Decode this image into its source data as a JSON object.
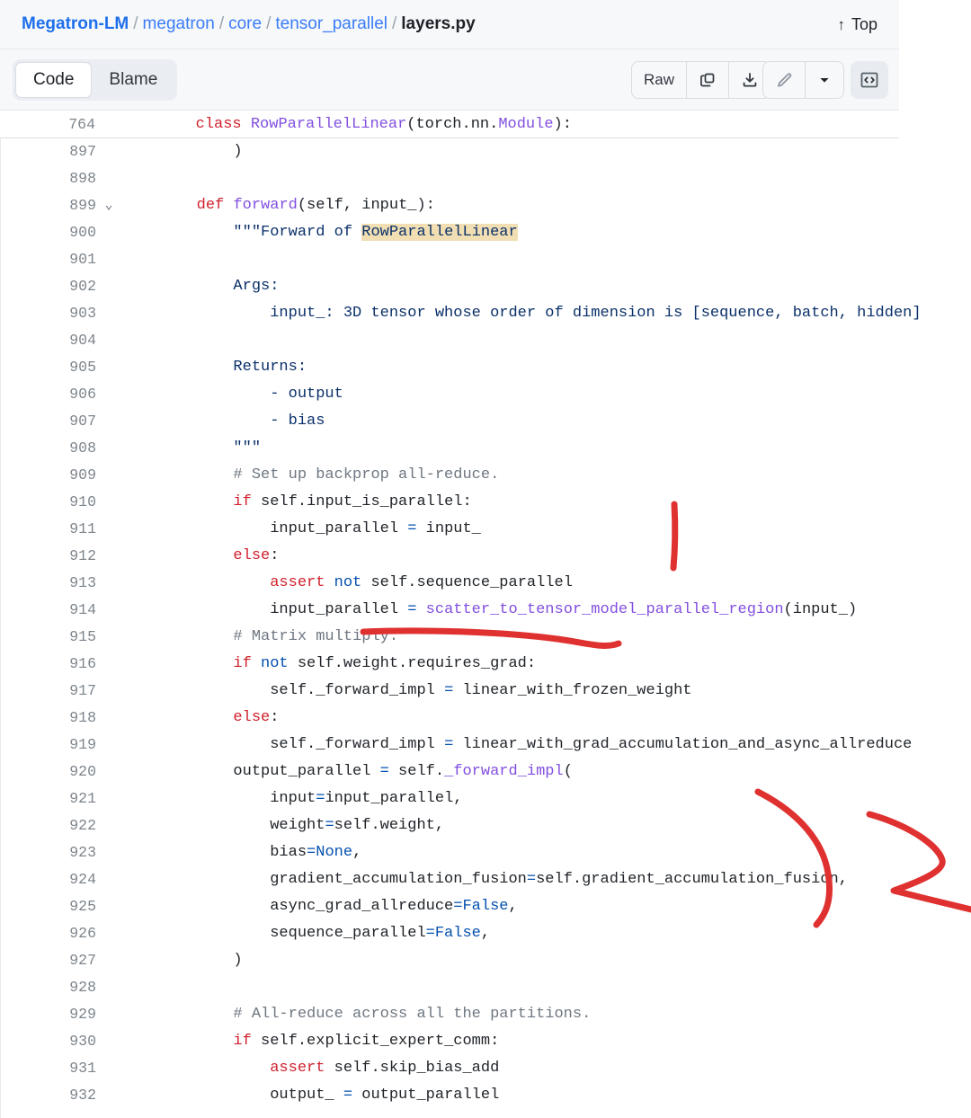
{
  "header": {
    "breadcrumb": {
      "repo": "Megatron-LM",
      "parts": [
        "megatron",
        "core",
        "tensor_parallel"
      ],
      "file": "layers.py",
      "separator": "/"
    },
    "top_label": "Top",
    "top_arrow": "↑"
  },
  "toolbar": {
    "tabs": [
      {
        "label": "Code",
        "active": true
      },
      {
        "label": "Blame",
        "active": false
      }
    ],
    "raw_label": "Raw",
    "icons": {
      "copy": "copy-icon",
      "download": "download-icon",
      "edit": "pencil-icon",
      "dropdown": "chevron-down-icon",
      "code_view": "code-symbol-icon"
    }
  },
  "sticky_line": {
    "number": "764",
    "tokens": [
      {
        "t": "        ",
        "c": ""
      },
      {
        "t": "class",
        "c": "kw"
      },
      {
        "t": " ",
        "c": ""
      },
      {
        "t": "RowParallelLinear",
        "c": "fn"
      },
      {
        "t": "(torch.nn.",
        "c": ""
      },
      {
        "t": "Module",
        "c": "fn"
      },
      {
        "t": "):",
        "c": ""
      }
    ]
  },
  "colors": {
    "keyword": "#cf222e",
    "constant": "#0550ae",
    "string": "#0a3069",
    "comment": "#6e7781",
    "function": "#8250df",
    "highlight": "#f1dfb3",
    "annotation": "#e03131",
    "link": "#3b7cf6",
    "chrome": "#f6f8fa"
  },
  "code_lines": [
    {
      "n": "897",
      "chev": false,
      "tokens": [
        {
          "t": "            )",
          "c": ""
        }
      ]
    },
    {
      "n": "898",
      "chev": false,
      "tokens": []
    },
    {
      "n": "899",
      "chev": true,
      "tokens": [
        {
          "t": "        ",
          "c": ""
        },
        {
          "t": "def",
          "c": "kw"
        },
        {
          "t": " ",
          "c": ""
        },
        {
          "t": "forward",
          "c": "fn"
        },
        {
          "t": "(self, input_):",
          "c": ""
        }
      ]
    },
    {
      "n": "900",
      "chev": false,
      "tokens": [
        {
          "t": "            ",
          "c": ""
        },
        {
          "t": "\"\"\"Forward of ",
          "c": "str"
        },
        {
          "t": "RowParallelLinear",
          "c": "str hl"
        }
      ]
    },
    {
      "n": "901",
      "chev": false,
      "tokens": []
    },
    {
      "n": "902",
      "chev": false,
      "tokens": [
        {
          "t": "            Args:",
          "c": "str"
        }
      ]
    },
    {
      "n": "903",
      "chev": false,
      "tokens": [
        {
          "t": "                input_: 3D tensor whose order of dimension is [sequence, batch, hidden]",
          "c": "str"
        }
      ]
    },
    {
      "n": "904",
      "chev": false,
      "tokens": []
    },
    {
      "n": "905",
      "chev": false,
      "tokens": [
        {
          "t": "            Returns:",
          "c": "str"
        }
      ]
    },
    {
      "n": "906",
      "chev": false,
      "tokens": [
        {
          "t": "                - output",
          "c": "str"
        }
      ]
    },
    {
      "n": "907",
      "chev": false,
      "tokens": [
        {
          "t": "                - bias",
          "c": "str"
        }
      ]
    },
    {
      "n": "908",
      "chev": false,
      "tokens": [
        {
          "t": "            \"\"\"",
          "c": "str"
        }
      ]
    },
    {
      "n": "909",
      "chev": false,
      "tokens": [
        {
          "t": "            # Set up backprop all-reduce.",
          "c": "com"
        }
      ]
    },
    {
      "n": "910",
      "chev": false,
      "tokens": [
        {
          "t": "            ",
          "c": ""
        },
        {
          "t": "if",
          "c": "kw"
        },
        {
          "t": " self.input_is_parallel:",
          "c": ""
        }
      ]
    },
    {
      "n": "911",
      "chev": false,
      "tokens": [
        {
          "t": "                input_parallel ",
          "c": ""
        },
        {
          "t": "=",
          "c": "op"
        },
        {
          "t": " input_",
          "c": ""
        }
      ]
    },
    {
      "n": "912",
      "chev": false,
      "tokens": [
        {
          "t": "            ",
          "c": ""
        },
        {
          "t": "else",
          "c": "kw"
        },
        {
          "t": ":",
          "c": ""
        }
      ]
    },
    {
      "n": "913",
      "chev": false,
      "tokens": [
        {
          "t": "                ",
          "c": ""
        },
        {
          "t": "assert",
          "c": "kw"
        },
        {
          "t": " ",
          "c": ""
        },
        {
          "t": "not",
          "c": "con"
        },
        {
          "t": " self.sequence_parallel",
          "c": ""
        }
      ]
    },
    {
      "n": "914",
      "chev": false,
      "tokens": [
        {
          "t": "                input_parallel ",
          "c": ""
        },
        {
          "t": "=",
          "c": "op"
        },
        {
          "t": " ",
          "c": ""
        },
        {
          "t": "scatter_to_tensor_model_parallel_region",
          "c": "fn"
        },
        {
          "t": "(input_)",
          "c": ""
        }
      ]
    },
    {
      "n": "915",
      "chev": false,
      "tokens": [
        {
          "t": "            # Matrix multiply.",
          "c": "com"
        }
      ]
    },
    {
      "n": "916",
      "chev": false,
      "tokens": [
        {
          "t": "            ",
          "c": ""
        },
        {
          "t": "if",
          "c": "kw"
        },
        {
          "t": " ",
          "c": ""
        },
        {
          "t": "not",
          "c": "con"
        },
        {
          "t": " self.weight.requires_grad:",
          "c": ""
        }
      ]
    },
    {
      "n": "917",
      "chev": false,
      "tokens": [
        {
          "t": "                self._forward_impl ",
          "c": ""
        },
        {
          "t": "=",
          "c": "op"
        },
        {
          "t": " linear_with_frozen_weight",
          "c": ""
        }
      ]
    },
    {
      "n": "918",
      "chev": false,
      "tokens": [
        {
          "t": "            ",
          "c": ""
        },
        {
          "t": "else",
          "c": "kw"
        },
        {
          "t": ":",
          "c": ""
        }
      ]
    },
    {
      "n": "919",
      "chev": false,
      "tokens": [
        {
          "t": "                self._forward_impl ",
          "c": ""
        },
        {
          "t": "=",
          "c": "op"
        },
        {
          "t": " linear_with_grad_accumulation_and_async_allreduce",
          "c": ""
        }
      ]
    },
    {
      "n": "920",
      "chev": false,
      "tokens": [
        {
          "t": "            output_parallel ",
          "c": ""
        },
        {
          "t": "=",
          "c": "op"
        },
        {
          "t": " self.",
          "c": ""
        },
        {
          "t": "_forward_impl",
          "c": "fn"
        },
        {
          "t": "(",
          "c": ""
        }
      ]
    },
    {
      "n": "921",
      "chev": false,
      "tokens": [
        {
          "t": "                input",
          "c": ""
        },
        {
          "t": "=",
          "c": "op"
        },
        {
          "t": "input_parallel,",
          "c": ""
        }
      ]
    },
    {
      "n": "922",
      "chev": false,
      "tokens": [
        {
          "t": "                weight",
          "c": ""
        },
        {
          "t": "=",
          "c": "op"
        },
        {
          "t": "self.weight,",
          "c": ""
        }
      ]
    },
    {
      "n": "923",
      "chev": false,
      "tokens": [
        {
          "t": "                bias",
          "c": ""
        },
        {
          "t": "=",
          "c": "op"
        },
        {
          "t": "None",
          "c": "con"
        },
        {
          "t": ",",
          "c": ""
        }
      ]
    },
    {
      "n": "924",
      "chev": false,
      "tokens": [
        {
          "t": "                gradient_accumulation_fusion",
          "c": ""
        },
        {
          "t": "=",
          "c": "op"
        },
        {
          "t": "self.gradient_accumulation_fusion,",
          "c": ""
        }
      ]
    },
    {
      "n": "925",
      "chev": false,
      "tokens": [
        {
          "t": "                async_grad_allreduce",
          "c": ""
        },
        {
          "t": "=",
          "c": "op"
        },
        {
          "t": "False",
          "c": "con"
        },
        {
          "t": ",",
          "c": ""
        }
      ]
    },
    {
      "n": "926",
      "chev": false,
      "tokens": [
        {
          "t": "                sequence_parallel",
          "c": ""
        },
        {
          "t": "=",
          "c": "op"
        },
        {
          "t": "False",
          "c": "con"
        },
        {
          "t": ",",
          "c": ""
        }
      ]
    },
    {
      "n": "927",
      "chev": false,
      "tokens": [
        {
          "t": "            )",
          "c": ""
        }
      ]
    },
    {
      "n": "928",
      "chev": false,
      "tokens": []
    },
    {
      "n": "929",
      "chev": false,
      "tokens": [
        {
          "t": "            # All-reduce across all the partitions.",
          "c": "com"
        }
      ]
    },
    {
      "n": "930",
      "chev": false,
      "tokens": [
        {
          "t": "            ",
          "c": ""
        },
        {
          "t": "if",
          "c": "kw"
        },
        {
          "t": " self.explicit_expert_comm:",
          "c": ""
        }
      ]
    },
    {
      "n": "931",
      "chev": false,
      "tokens": [
        {
          "t": "                ",
          "c": ""
        },
        {
          "t": "assert",
          "c": "kw"
        },
        {
          "t": " self.skip_bias_add",
          "c": ""
        }
      ]
    },
    {
      "n": "932",
      "chev": false,
      "tokens": [
        {
          "t": "                output_ ",
          "c": ""
        },
        {
          "t": "=",
          "c": "op"
        },
        {
          "t": " output_parallel",
          "c": ""
        }
      ]
    }
  ],
  "annotations": [
    {
      "name": "vertical-stroke"
    },
    {
      "name": "horizontal-underline-stroke"
    },
    {
      "name": "curved-bracket-stroke"
    },
    {
      "name": "arrow-chevron-stroke"
    }
  ]
}
